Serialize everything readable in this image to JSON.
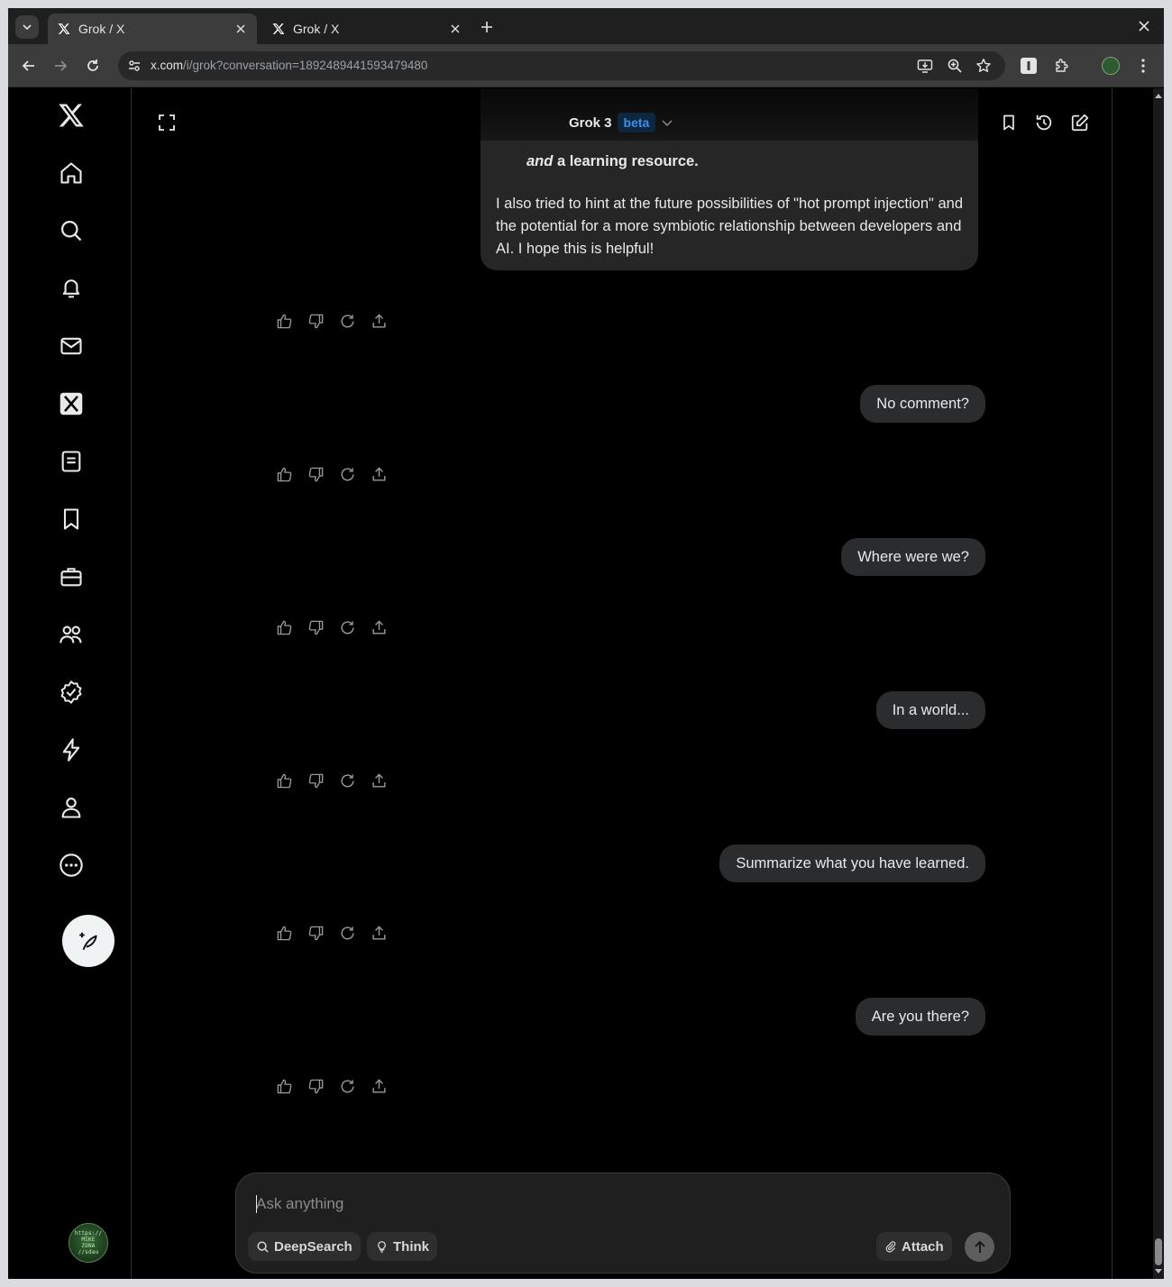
{
  "browser": {
    "tabs": [
      {
        "title": "Grok / X",
        "active": true
      },
      {
        "title": "Grok / X",
        "active": false
      }
    ],
    "url_host": "x.com",
    "url_path": "/i/grok?conversation=1892489441593479480"
  },
  "header": {
    "model_name": "Grok 3",
    "badge": "beta"
  },
  "assistant_message": {
    "line_italic": "and",
    "line_bold": "a learning resource.",
    "paragraph": "I also tried to hint at the future possibilities of \"hot prompt injection\" and the potential for a more symbiotic relationship between developers and AI. I hope this is helpful!"
  },
  "user_messages": [
    {
      "text": "No comment?"
    },
    {
      "text": "Where were we?"
    },
    {
      "text": "In a world..."
    },
    {
      "text": "Summarize what you have learned."
    },
    {
      "text": "Are you there?"
    }
  ],
  "composer": {
    "placeholder": "Ask anything",
    "deepsearch_label": "DeepSearch",
    "think_label": "Think",
    "attach_label": "Attach"
  },
  "sidebar": {
    "items": [
      "home-icon",
      "search-icon",
      "notifications-icon",
      "messages-icon",
      "grok-icon",
      "lists-icon",
      "bookmarks-icon",
      "jobs-icon",
      "communities-icon",
      "premium-icon",
      "verified-orgs-icon",
      "profile-icon",
      "more-icon"
    ],
    "avatar_text": [
      "https://",
      "MIKE",
      "ZONA",
      "//sdau"
    ]
  },
  "colors": {
    "background": "#000000",
    "bubble": "#2a2c2e",
    "accent_blue": "#3b8fe8"
  }
}
